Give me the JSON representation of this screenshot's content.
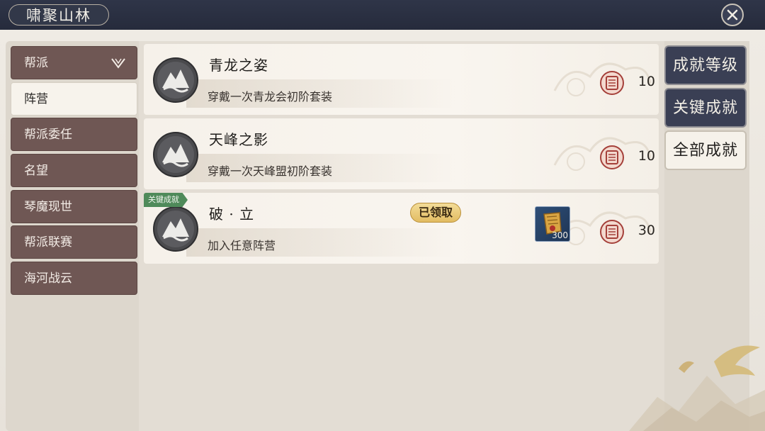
{
  "window": {
    "title": "啸聚山林",
    "close_icon": "close-icon"
  },
  "sidebar": {
    "items": [
      {
        "label": "帮派",
        "active": false,
        "expandable": true
      },
      {
        "label": "阵营",
        "active": true
      },
      {
        "label": "帮派委任",
        "active": false
      },
      {
        "label": "名望",
        "active": false
      },
      {
        "label": "琴魔现世",
        "active": false
      },
      {
        "label": "帮派联赛",
        "active": false
      },
      {
        "label": "海河战云",
        "active": false
      }
    ]
  },
  "achievements": [
    {
      "name": "青龙之姿",
      "description": "穿戴一次青龙会初阶套装",
      "points": "10"
    },
    {
      "name": "天峰之影",
      "description": "穿戴一次天峰盟初阶套装",
      "points": "10"
    },
    {
      "name": "破 · 立",
      "description": "加入任意阵营",
      "points": "30",
      "tag": "关键成就",
      "status": "已领取",
      "reward_qty": "300"
    }
  ],
  "right_tabs": [
    {
      "label": "成就等级",
      "style": "dark"
    },
    {
      "label": "关键成就",
      "style": "dark"
    },
    {
      "label": "全部成就",
      "style": "light"
    }
  ],
  "colors": {
    "topbar": "#2f3548",
    "nav_item": "#6f5754",
    "tag_green": "#4f8a5a",
    "badge_gold": "#e2bc62",
    "seal_red": "#a5403a"
  }
}
